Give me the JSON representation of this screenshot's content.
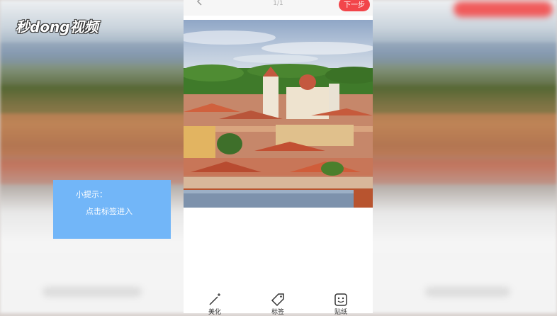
{
  "watermark": {
    "logo_text": "秒dong视频"
  },
  "phone": {
    "page_indicator": "1/1",
    "next_button_label": "下一步",
    "toolbar": [
      {
        "label": "美化",
        "icon": "magic-wand-icon"
      },
      {
        "label": "标签",
        "icon": "tag-icon"
      },
      {
        "label": "贴纸",
        "icon": "sticker-icon"
      }
    ]
  },
  "tip": {
    "title": "小提示：",
    "body": "点击标签进入"
  },
  "colors": {
    "accent": "#f2454a",
    "tip_background": "#72b6f8"
  }
}
